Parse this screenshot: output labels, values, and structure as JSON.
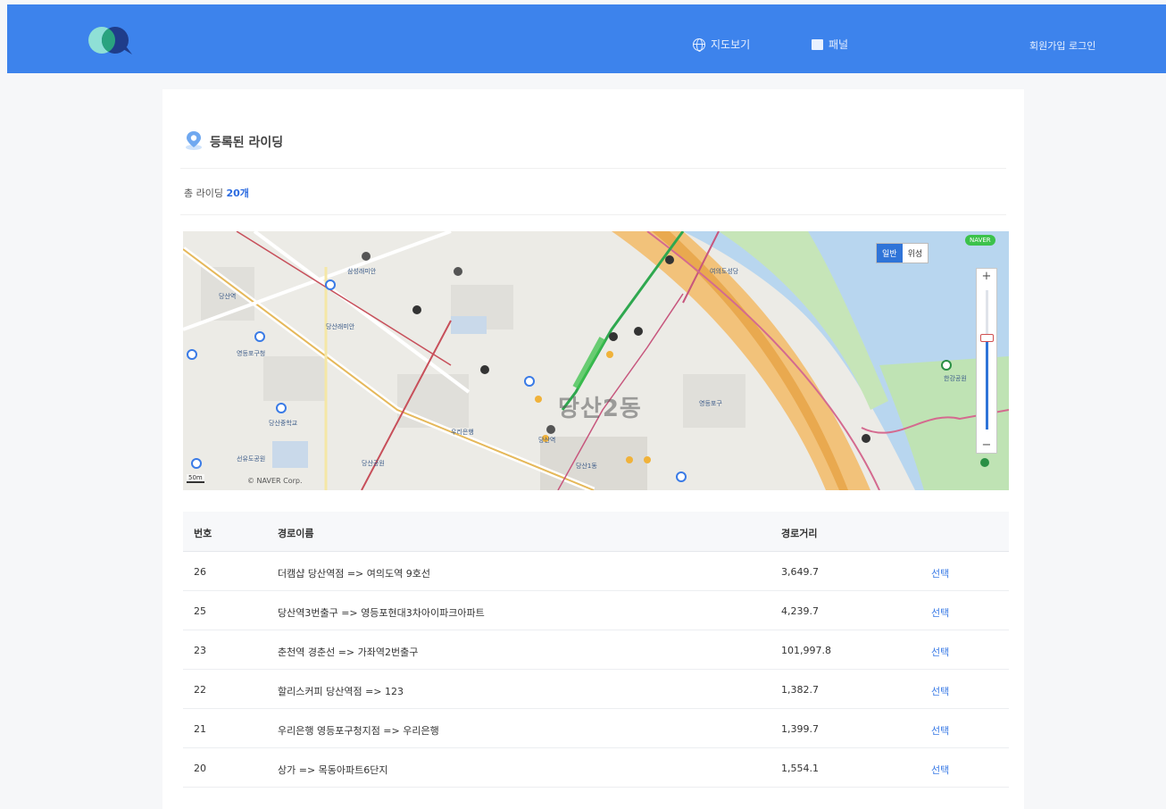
{
  "header": {
    "nav": [
      {
        "icon": "globe-icon",
        "label": "지도보기"
      },
      {
        "icon": "card-icon",
        "label": "패널"
      }
    ],
    "login_label": "회원가입 로그인"
  },
  "colors": {
    "header": "#3d83ec",
    "accent": "#2c6be0",
    "link": "#3a7be6"
  },
  "page": {
    "title": "등록된 라이딩",
    "total_prefix": "총 라이딩",
    "total_count": "20개"
  },
  "map": {
    "type_options": [
      "일반",
      "위성"
    ],
    "selected_type": "일반",
    "badge": "NAVER",
    "zoom_level": 0.65,
    "area_label": "당산2동",
    "copyright": "© NAVER Corp.",
    "scale_label": "50m",
    "pois": [
      "당산역",
      "영등포구청",
      "당산중학교",
      "당산래미안",
      "선유도공원",
      "당산공원",
      "삼성래미안",
      "당산역",
      "한강공원",
      "우리은행",
      "영등포구",
      "당산1동",
      "여의도성당"
    ]
  },
  "table": {
    "headers": [
      "번호",
      "경로이름",
      "경로거리",
      ""
    ],
    "rows": [
      {
        "no": "26",
        "name": "더캠샵 당산역점 => 여의도역 9호선",
        "dist": "3,649.7",
        "action": "선택"
      },
      {
        "no": "25",
        "name": "당산역3번출구 => 영등포현대3차아이파크아파트",
        "dist": "4,239.7",
        "action": "선택"
      },
      {
        "no": "23",
        "name": "춘천역 경춘선 => 가좌역2번출구",
        "dist": "101,997.8",
        "action": "선택"
      },
      {
        "no": "22",
        "name": "할리스커피 당산역점 => 123",
        "dist": "1,382.7",
        "action": "선택"
      },
      {
        "no": "21",
        "name": "우리은행 영등포구청지점 => 우리은행",
        "dist": "1,399.7",
        "action": "선택"
      },
      {
        "no": "20",
        "name": "상가 => 목동아파트6단지",
        "dist": "1,554.1",
        "action": "선택"
      }
    ]
  }
}
